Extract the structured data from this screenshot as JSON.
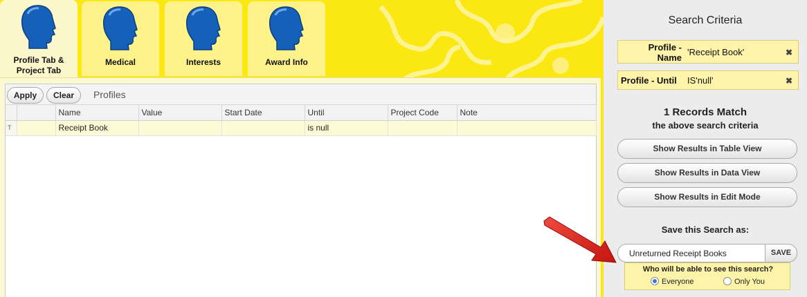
{
  "tabs": [
    {
      "label": "Profile Tab &\nProject Tab",
      "label_line1": "Profile Tab &",
      "label_line2": "Project Tab",
      "active": true,
      "icon": "person-head-icon"
    },
    {
      "label": "Medical",
      "active": false,
      "icon": "person-head-icon"
    },
    {
      "label": "Interests",
      "active": false,
      "icon": "person-head-icon"
    },
    {
      "label": "Award Info",
      "active": false,
      "icon": "person-head-icon"
    }
  ],
  "toolbar": {
    "apply_label": "Apply",
    "clear_label": "Clear",
    "title": "Profiles"
  },
  "grid": {
    "columns": [
      "Name",
      "Value",
      "Start Date",
      "Until",
      "Project Code",
      "Note"
    ],
    "filter_row": {
      "indicator": "T",
      "cells": [
        "Receipt Book",
        "",
        "",
        "is null",
        "",
        ""
      ]
    }
  },
  "search": {
    "title": "Search Criteria",
    "criteria": [
      {
        "label_line1": "Profile -",
        "label_line2": "Name",
        "value": "'Receipt Book'",
        "remove": "✖"
      },
      {
        "label": "Profile - Until",
        "value": "IS'null'",
        "remove": "✖"
      }
    ],
    "match_count": "1 Records Match",
    "match_text": "the above search criteria",
    "buttons": [
      "Show Results in Table View",
      "Show Results in Data View",
      "Show Results in Edit Mode"
    ],
    "save_label": "Save this Search as:",
    "save_value": "Unreturned Receipt Books",
    "save_button": "SAVE",
    "visibility_question": "Who will be able to see this search?",
    "visibility_options": [
      {
        "label": "Everyone",
        "selected": true
      },
      {
        "label": "Only You",
        "selected": false
      }
    ]
  },
  "colors": {
    "background_yellow": "#fbe711",
    "tab": "#fdf38a",
    "criteria_bg": "#fdf3a9",
    "head_blue": "#1560b8",
    "arrow_red": "#e0231c"
  }
}
